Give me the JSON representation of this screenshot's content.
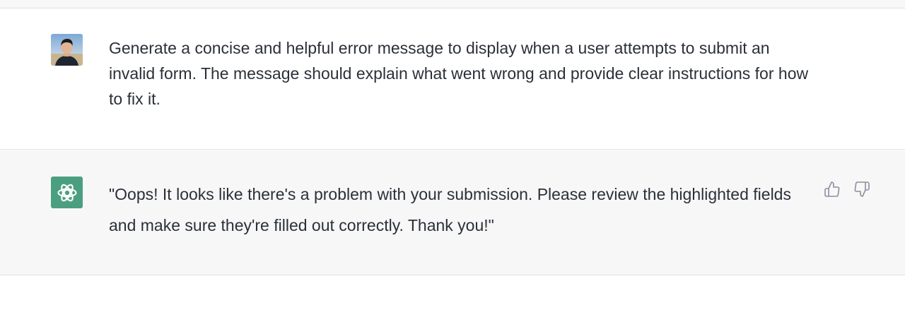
{
  "conversation": {
    "user_message": {
      "avatar": "user-photo-avatar",
      "text": "Generate a concise and helpful error message to display when a user attempts to submit an invalid form. The message should explain what went wrong and provide clear instructions for how to fix it."
    },
    "assistant_message": {
      "avatar": "openai-logo-icon",
      "text": "\"Oops! It looks like there's a problem with your submission. Please review the highlighted fields and make sure they're filled out correctly. Thank you!\"",
      "feedback": {
        "thumbs_up_icon": "thumbs-up-icon",
        "thumbs_down_icon": "thumbs-down-icon"
      }
    }
  },
  "colors": {
    "assistant_bg": "#f7f7f8",
    "user_bg": "#ffffff",
    "assistant_avatar_bg": "#4b9f81",
    "text": "#2b3038",
    "divider": "#e0e0e3"
  }
}
